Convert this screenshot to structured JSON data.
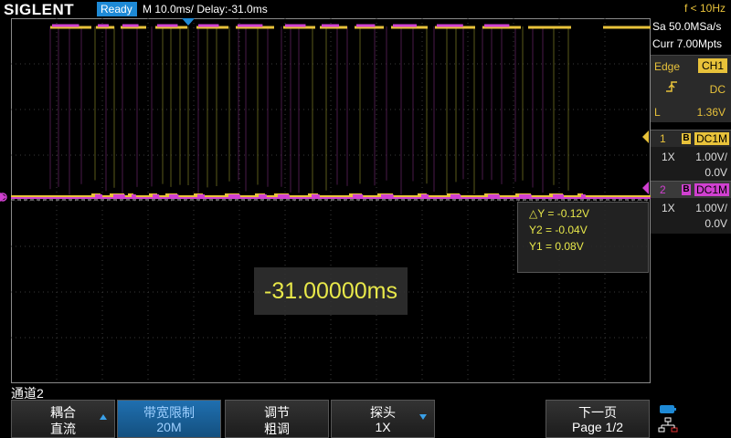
{
  "header": {
    "logo": "SIGLENT",
    "status": "Ready",
    "timebase": "M 10.0ms/ Delay:-31.0ms",
    "trigger_freq": "f < 10Hz"
  },
  "acquisition": {
    "sample_rate": "Sa 50.0MSa/s",
    "memory_depth": "Curr 7.00Mpts"
  },
  "trigger": {
    "type": "Edge",
    "source": "CH1",
    "slope_icon": "rising-edge-icon",
    "coupling": "DC",
    "level_label": "L",
    "level": "1.36V"
  },
  "channels": [
    {
      "number": "1",
      "bw_limit": "B",
      "coupling": "DC1M",
      "probe": "1X",
      "scale": "1.00V/",
      "offset": "0.0V",
      "color": "#e8c23a"
    },
    {
      "number": "2",
      "bw_limit": "B",
      "coupling": "DC1M",
      "probe": "1X",
      "scale": "1.00V/",
      "offset": "0.0V",
      "color": "#d040d0"
    }
  ],
  "cursors": {
    "delta_y": "△Y = -0.12V",
    "y2": "Y2 = -0.04V",
    "y1": "Y1 = 0.08V"
  },
  "delay_readout": "-31.00000ms",
  "menu": {
    "title": "通道2",
    "softkeys": [
      {
        "line1": "耦合",
        "line2": "直流"
      },
      {
        "line1": "带宽限制",
        "line2": "20M"
      },
      {
        "line1": "调节",
        "line2": "粗调"
      },
      {
        "line1": "探头",
        "line2": "1X"
      },
      {
        "line1": "下一页",
        "line2": "Page 1/2"
      }
    ]
  },
  "colors": {
    "ch1": "#e8c23a",
    "ch2": "#d040d0",
    "accent": "#1e8ad6"
  }
}
